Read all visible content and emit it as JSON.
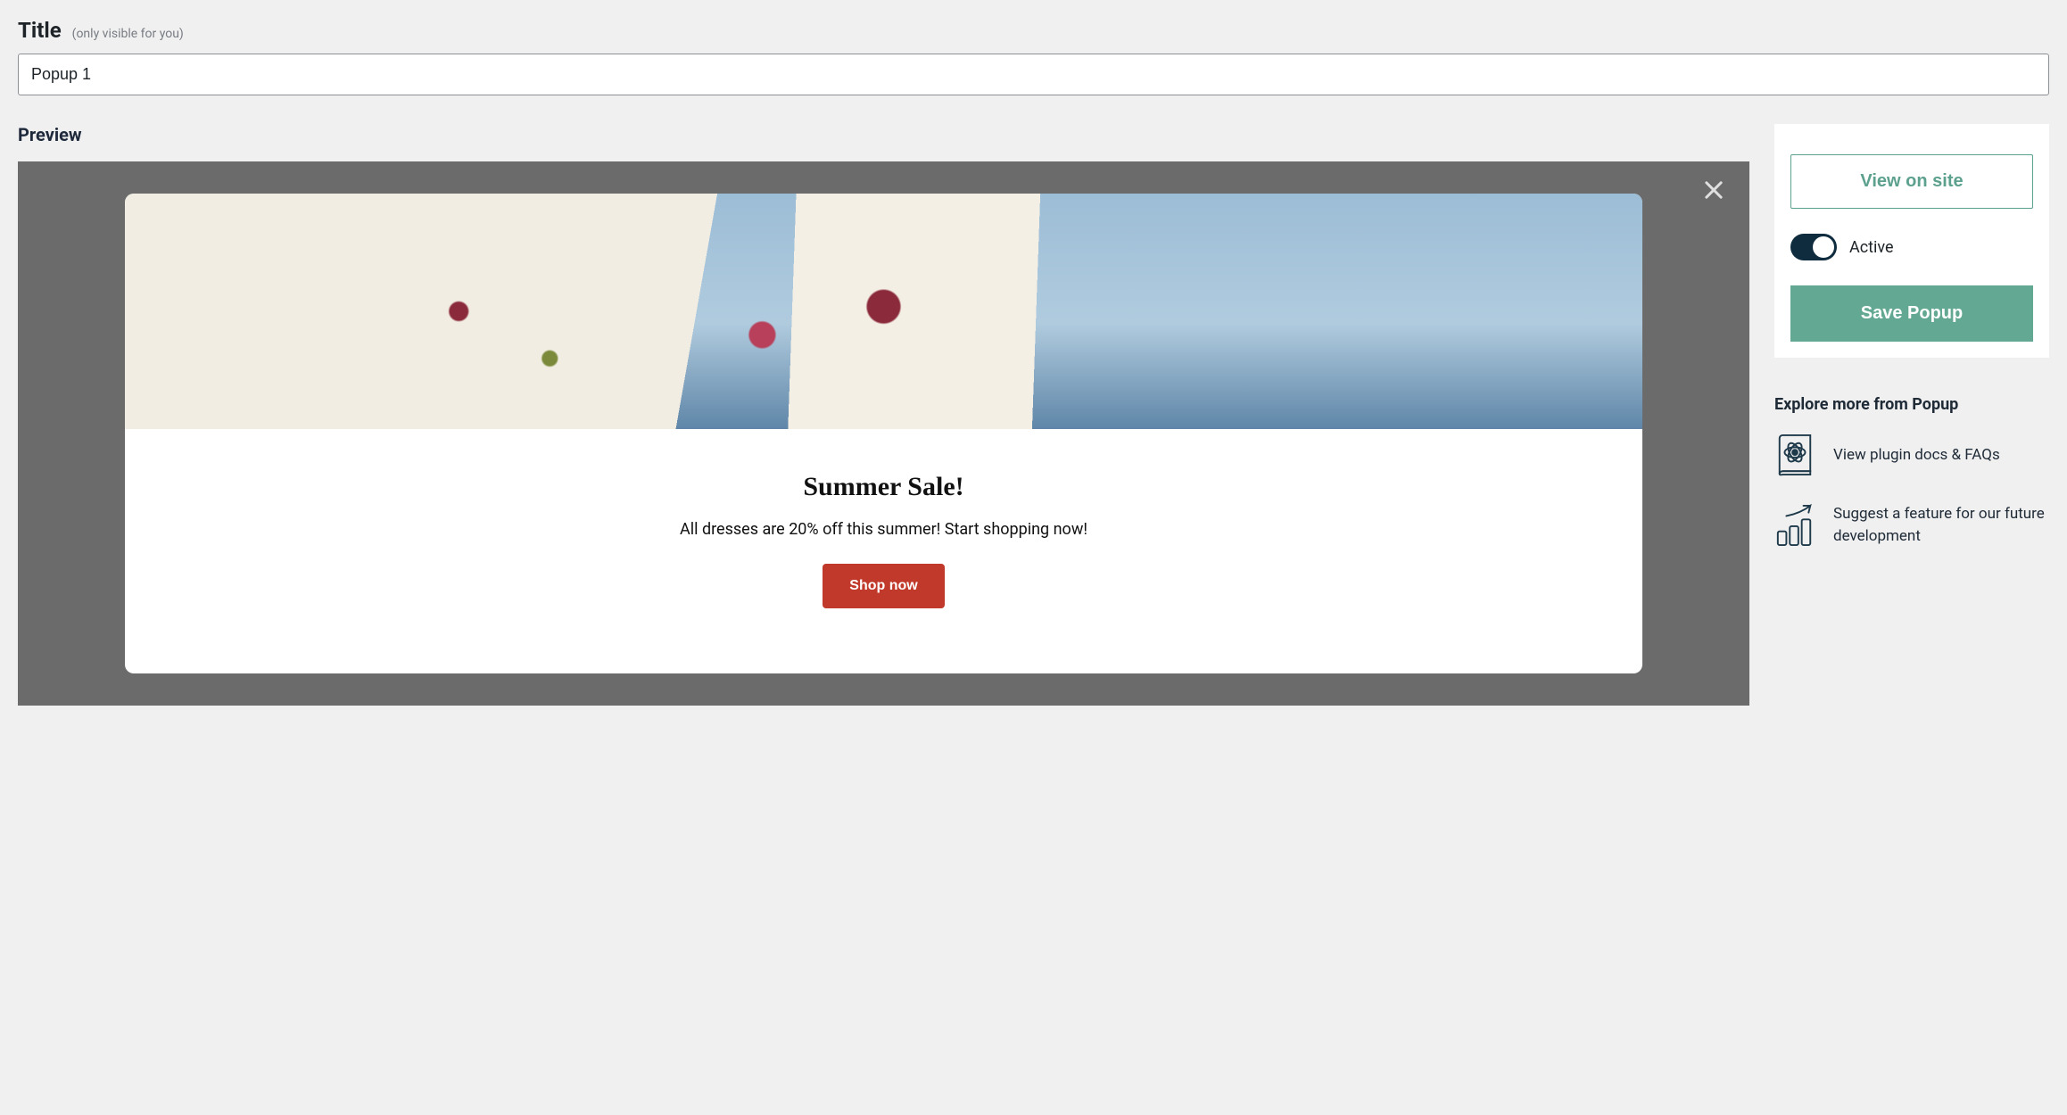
{
  "title_section": {
    "label": "Title",
    "hint": "(only visible for you)",
    "value": "Popup 1"
  },
  "preview": {
    "label": "Preview",
    "popup": {
      "heading": "Summer Sale!",
      "subheading": "All dresses are 20% off this summer! Start shopping now!",
      "cta": "Shop now"
    }
  },
  "sidebar": {
    "view_on_site": "View on site",
    "active_toggle": {
      "label": "Active",
      "on": true
    },
    "save": "Save Popup"
  },
  "explore": {
    "heading": "Explore more from Popup",
    "items": [
      {
        "label": "View plugin docs & FAQs"
      },
      {
        "label": "Suggest a feature for our future development"
      }
    ]
  }
}
